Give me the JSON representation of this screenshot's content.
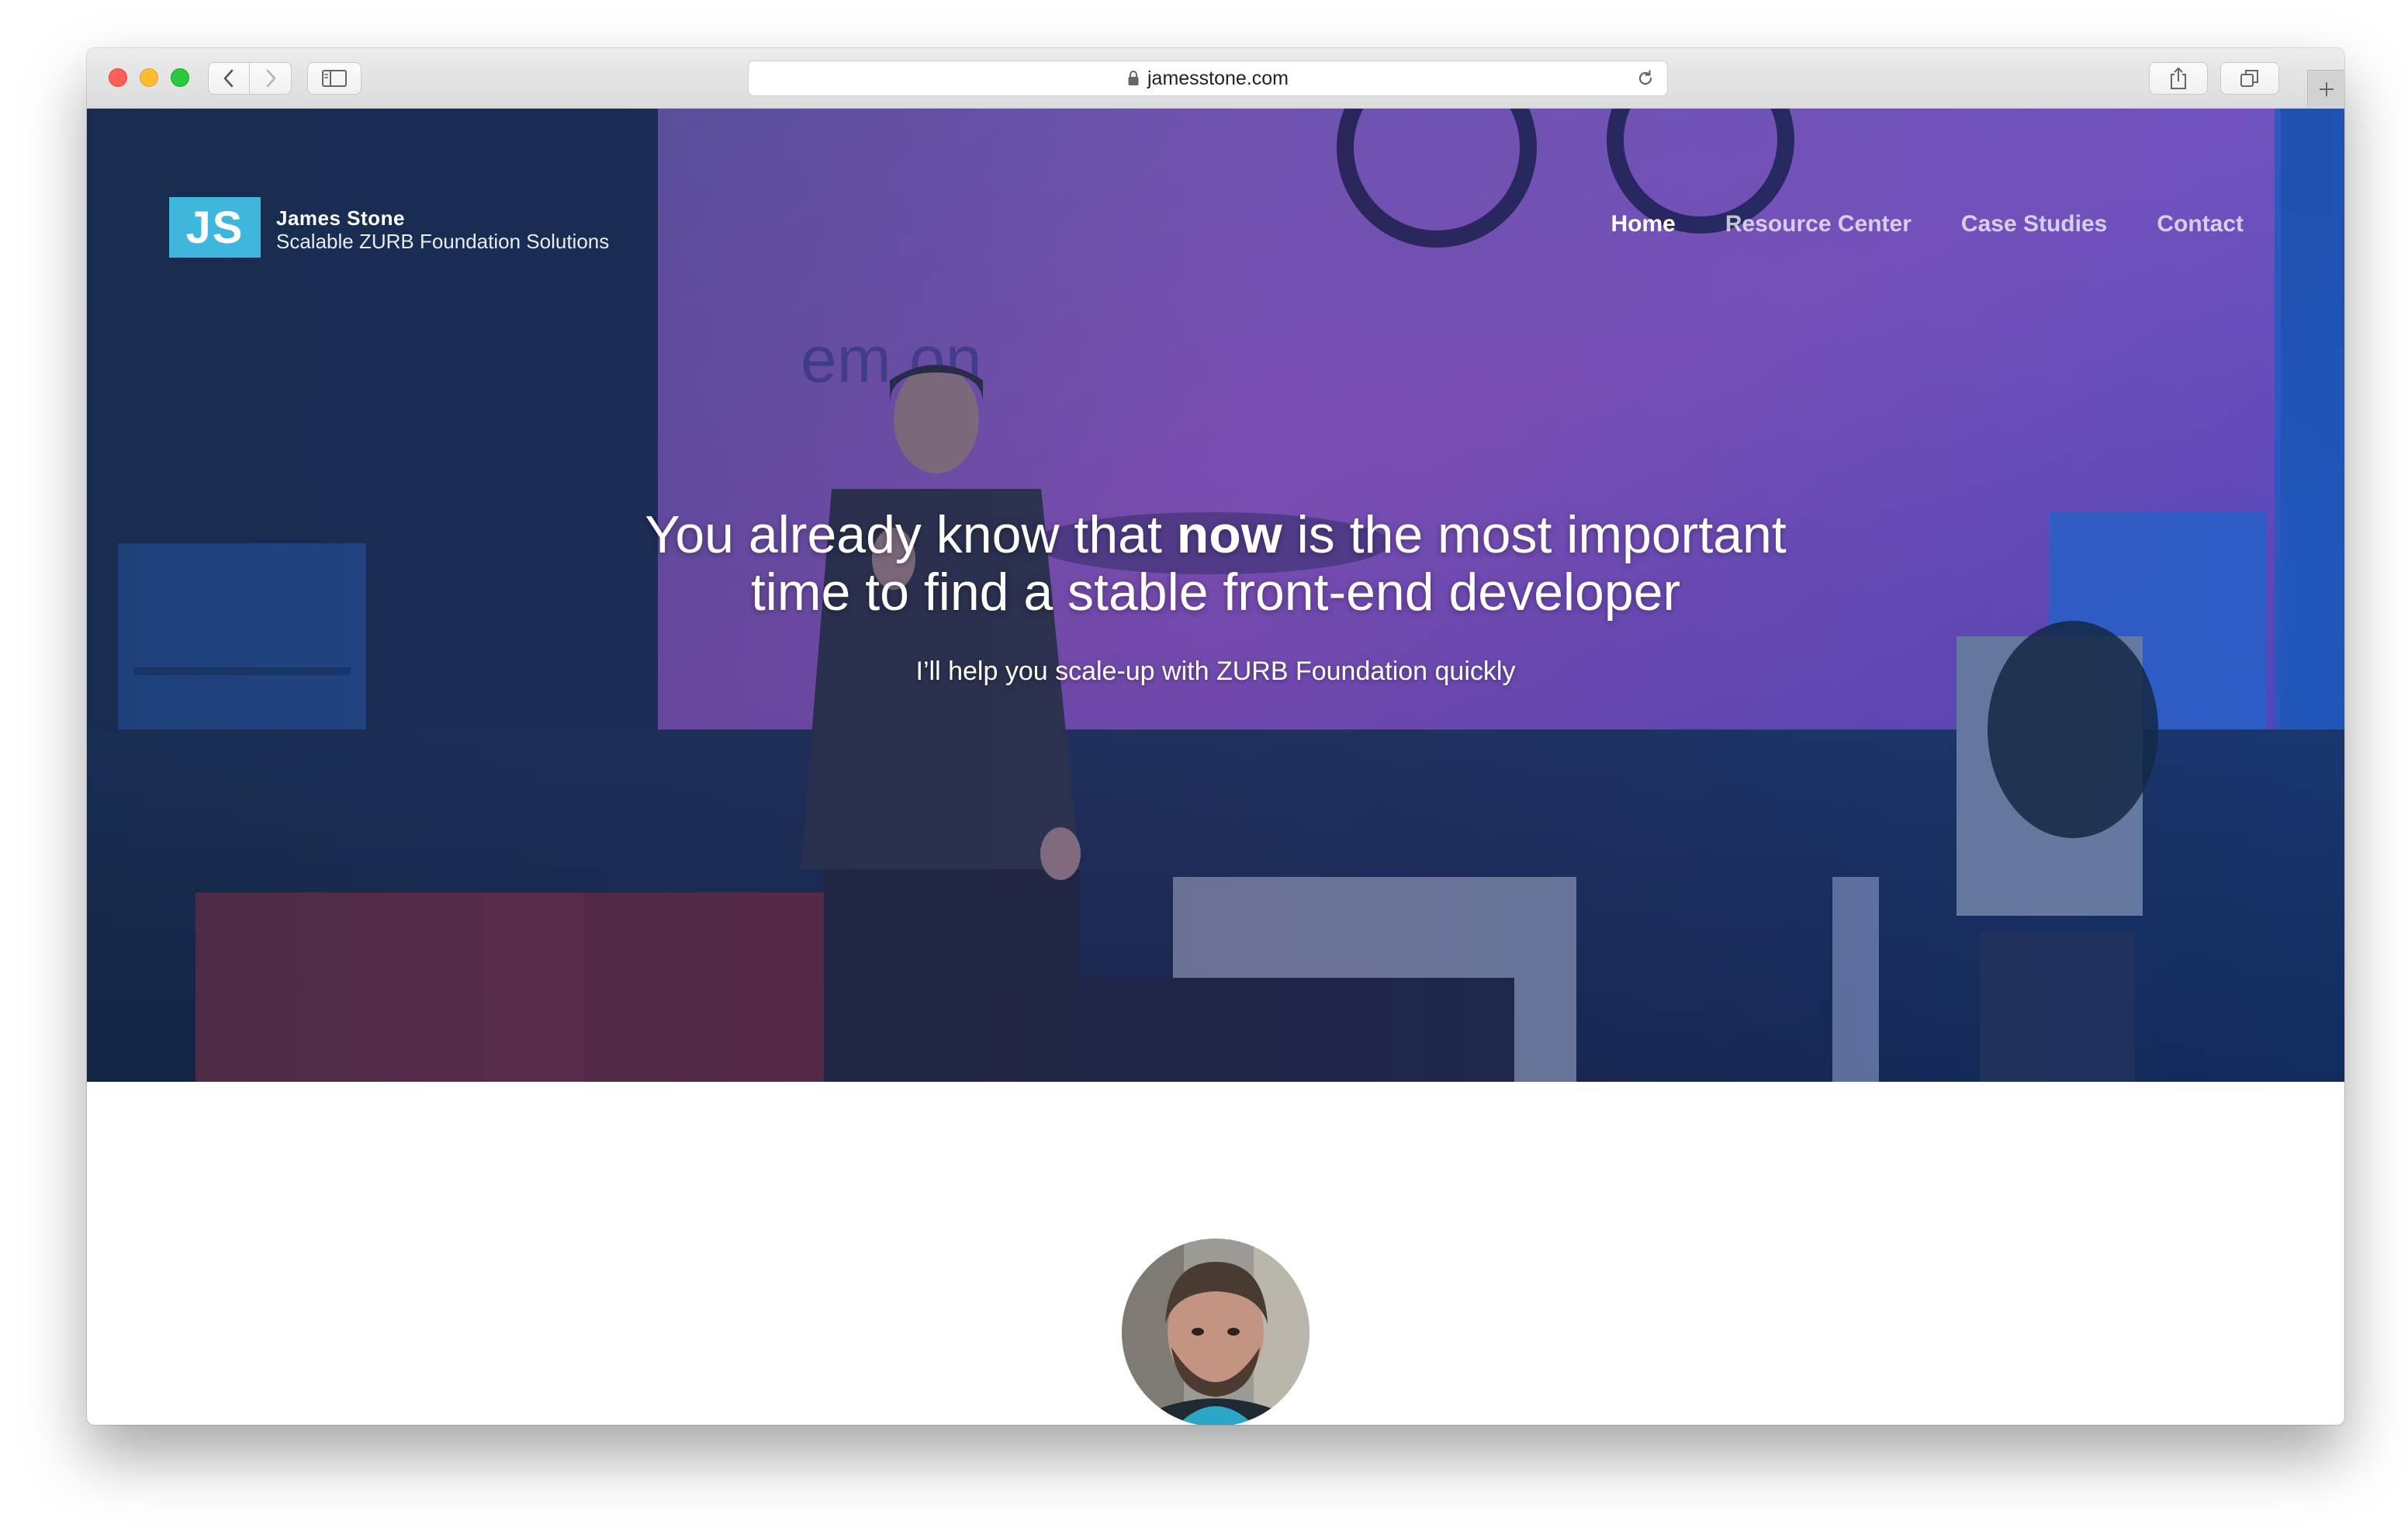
{
  "browser": {
    "url": "jamesstone.com",
    "icons": {
      "back": "chevron-left-icon",
      "forward": "chevron-right-icon",
      "sidebar": "sidebar-icon",
      "lock": "lock-icon",
      "reload": "reload-icon",
      "share": "share-icon",
      "tabs": "tabs-icon",
      "new_tab": "plus-icon"
    }
  },
  "site": {
    "logo_initials": "JS",
    "name": "James Stone",
    "tagline": "Scalable ZURB Foundation Solutions",
    "accent_color": "#3fb6dc"
  },
  "nav": {
    "items": [
      {
        "label": "Home",
        "active": true
      },
      {
        "label": "Resource Center",
        "active": false
      },
      {
        "label": "Case Studies",
        "active": false
      },
      {
        "label": "Contact",
        "active": false
      }
    ]
  },
  "hero": {
    "headline_pre": "You already know that ",
    "headline_bold": "now",
    "headline_post": " is the most important",
    "headline_line2": "time to find a stable front-end developer",
    "subheadline": "I’ll help you scale-up with ZURB Foundation quickly"
  }
}
